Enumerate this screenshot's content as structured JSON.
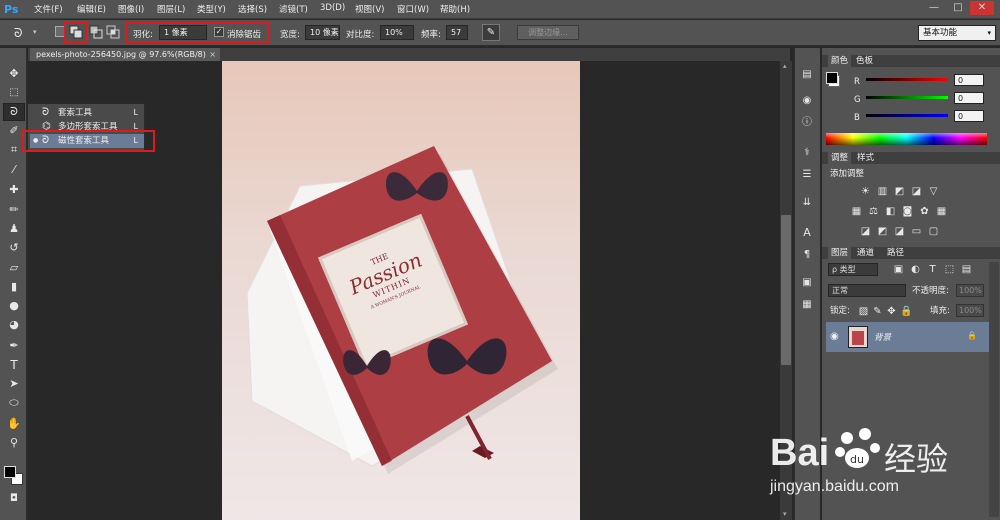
{
  "app": {
    "logo": "Ps"
  },
  "menubar": {
    "items": [
      "文件(F)",
      "编辑(E)",
      "图像(I)",
      "图层(L)",
      "类型(Y)",
      "选择(S)",
      "滤镜(T)",
      "3D(D)",
      "视图(V)",
      "窗口(W)",
      "帮助(H)"
    ],
    "window_controls": {
      "minimize": "—",
      "maximize": "□",
      "close": "✕"
    }
  },
  "options": {
    "feather_label": "羽化:",
    "feather_value": "1 像素",
    "antialias_label": "消除锯齿",
    "width_label": "宽度:",
    "width_value": "10 像素",
    "contrast_label": "对比度:",
    "contrast_value": "10%",
    "frequency_label": "频率:",
    "frequency_value": "57",
    "refine_edge_button": "调整边缘...",
    "workspace": "基本功能"
  },
  "document": {
    "tab_title": "pexels-photo-256450.jpg @ 97.6%(RGB/8)"
  },
  "lasso_flyout": {
    "items": [
      {
        "label": "套索工具",
        "key": "L"
      },
      {
        "label": "多边形套索工具",
        "key": "L"
      },
      {
        "label": "磁性套索工具",
        "key": "L"
      }
    ]
  },
  "photo": {
    "line1": "THE",
    "line2": "Passion",
    "line3": "WITHIN",
    "line4": "A WOMAN'S JOURNAL"
  },
  "color_panel": {
    "tab1": "颜色",
    "tab2": "色板",
    "r_label": "R",
    "g_label": "G",
    "b_label": "B",
    "r_value": "0",
    "g_value": "0",
    "b_value": "0"
  },
  "adjust_panel": {
    "tab1": "调整",
    "tab2": "样式",
    "heading": "添加调整"
  },
  "layers_panel": {
    "tab1": "图层",
    "tab2": "通道",
    "tab3": "路径",
    "filter_label": "ρ 类型",
    "blend_mode": "正常",
    "opacity_label": "不透明度:",
    "opacity_value": "100%",
    "lock_label": "锁定:",
    "fill_label": "填充:",
    "fill_value": "100%",
    "layer_name": "背景"
  },
  "watermark": {
    "brand": "Bai",
    "brand2": "经验",
    "url": "jingyan.baidu.com"
  }
}
